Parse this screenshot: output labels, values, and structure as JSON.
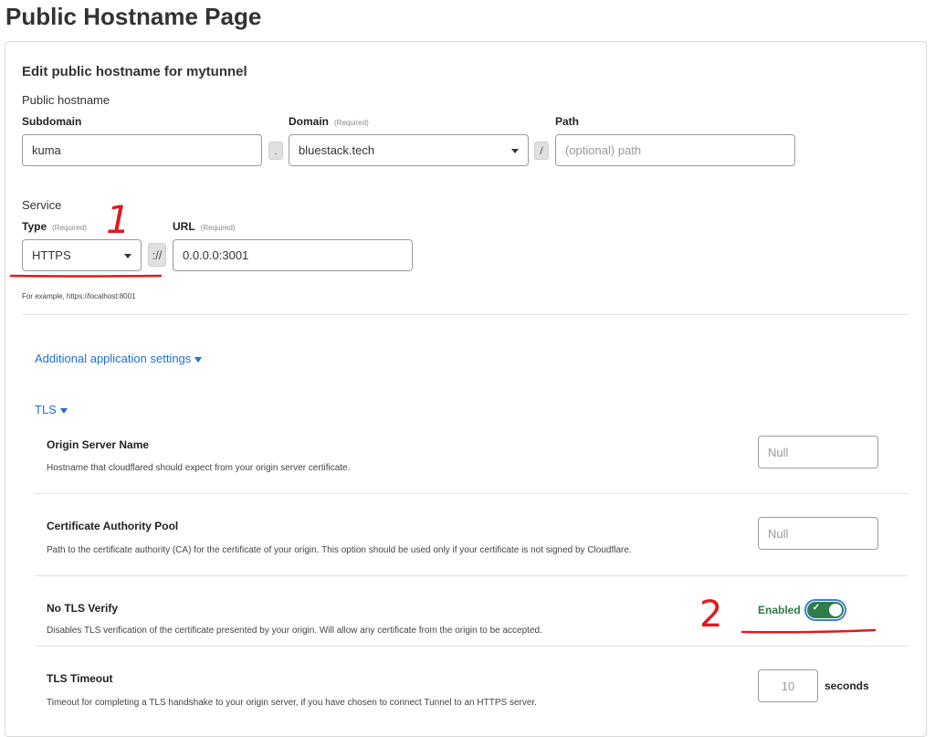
{
  "page_title": "Public Hostname Page",
  "card_title": "Edit public hostname for mytunnel",
  "public_hostname": {
    "section_label": "Public hostname",
    "subdomain": {
      "label": "Subdomain",
      "value": "kuma"
    },
    "dot": ".",
    "domain": {
      "label": "Domain",
      "required": "(Required)",
      "value": "bluestack.tech"
    },
    "slash": "/",
    "path": {
      "label": "Path",
      "placeholder": "(optional) path"
    }
  },
  "service": {
    "section_label": "Service",
    "type": {
      "label": "Type",
      "required": "(Required)",
      "value": "HTTPS"
    },
    "scheme_sep": "://",
    "url": {
      "label": "URL",
      "required": "(Required)",
      "value": "0.0.0.0:3001"
    },
    "hint": "For example, https://localhost:8001"
  },
  "additional_settings": {
    "label": "Additional application settings"
  },
  "tls": {
    "label": "TLS",
    "settings": [
      {
        "title": "Origin Server Name",
        "description": "Hostname that cloudflared should expect from your origin server certificate.",
        "placeholder": "Null"
      },
      {
        "title": "Certificate Authority Pool",
        "description": "Path to the certificate authority (CA) for the certificate of your origin. This option should be used only if your certificate is not signed by Cloudflare.",
        "placeholder": "Null"
      },
      {
        "title": "No TLS Verify",
        "description": "Disables TLS verification of the certificate presented by your origin. Will allow any certificate from the origin to be accepted.",
        "toggle_label": "Enabled",
        "toggle_on": true
      },
      {
        "title": "TLS Timeout",
        "description": "Timeout for completing a TLS handshake to your origin server, if you have chosen to connect Tunnel to an HTTPS server.",
        "placeholder": "10",
        "unit": "seconds"
      }
    ]
  },
  "annotations": {
    "mark_1": "1",
    "mark_2": "2"
  },
  "colors": {
    "accent": "#1f6fd0",
    "toggle_on": "#2e7d4a",
    "annotation": "#e0191f"
  }
}
